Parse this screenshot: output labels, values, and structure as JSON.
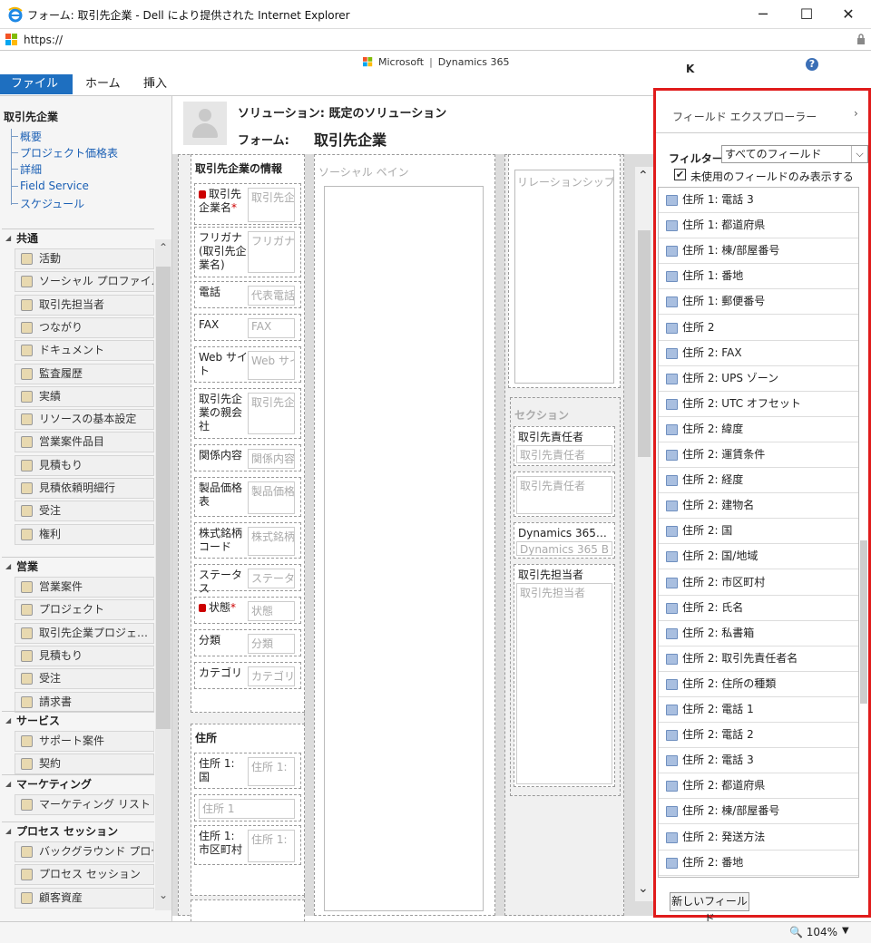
{
  "window": {
    "title": "フォーム: 取引先企業 - Dell により提供された Internet Explorer",
    "minimize": "─",
    "maximize": "☐",
    "close": "✕"
  },
  "address": {
    "url": "https://"
  },
  "brand": {
    "microsoft": "Microsoft",
    "product": "Dynamics 365",
    "sep": "|"
  },
  "user": {
    "initial": "K"
  },
  "help": "?",
  "ribbon": {
    "file": "ファイル",
    "home": "ホーム",
    "insert": "挿入"
  },
  "nav": {
    "entity": "取引先企業",
    "links": [
      "概要",
      "プロジェクト価格表",
      "詳細",
      "Field Service",
      "スケジュール"
    ],
    "groups": [
      {
        "label": "共通",
        "items": [
          "活動",
          "ソーシャル プロファイル",
          "取引先担当者",
          "つながり",
          "ドキュメント",
          "監査履歴",
          "実績",
          "リソースの基本設定",
          "営業案件品目",
          "見積もり",
          "見積依頼明細行",
          "受注",
          "権利"
        ]
      },
      {
        "label": "営業",
        "items": [
          "営業案件",
          "プロジェクト",
          "取引先企業プロジェ…",
          "見積もり",
          "受注",
          "請求書"
        ]
      },
      {
        "label": "サービス",
        "items": [
          "サポート案件",
          "契約"
        ]
      },
      {
        "label": "マーケティング",
        "items": [
          "マーケティング リスト"
        ]
      },
      {
        "label": "プロセス セッション",
        "items": [
          "バックグラウンド プロセス",
          "プロセス セッション",
          "顧客資産"
        ]
      }
    ]
  },
  "formhead": {
    "solution": "ソリューション: 既定のソリューション",
    "form_label": "フォーム:",
    "form_name": "取引先企業"
  },
  "form": {
    "section_info": "取引先企業の情報",
    "fields": [
      {
        "label": "取引先企業名",
        "placeholder": "取引先企",
        "required": "*"
      },
      {
        "label": "フリガナ (取引先企業名)",
        "placeholder": "フリガナ ("
      },
      {
        "label": "電話",
        "placeholder": "代表電話"
      },
      {
        "label": "FAX",
        "placeholder": "FAX"
      },
      {
        "label": "Web サイト",
        "placeholder": "Web サイ"
      },
      {
        "label": "取引先企業の親会社",
        "placeholder": "取引先企"
      },
      {
        "label": "関係内容",
        "placeholder": "関係内容"
      },
      {
        "label": "製品価格表",
        "placeholder": "製品価格"
      },
      {
        "label": "株式銘柄コード",
        "placeholder": "株式銘柄"
      },
      {
        "label": "ステータス",
        "placeholder": "ステータス"
      },
      {
        "label": "状態",
        "placeholder": "状態",
        "required": "*"
      },
      {
        "label": "分類",
        "placeholder": "分類"
      },
      {
        "label": "カテゴリ",
        "placeholder": "カテゴリ"
      }
    ],
    "section_address": "住所",
    "address_fields": [
      {
        "label": "住所 1: 国",
        "placeholder": "住所 1:"
      },
      {
        "label": "",
        "placeholder": "住所 1"
      },
      {
        "label": "住所 1: 市区町村",
        "placeholder": "住所 1:"
      }
    ],
    "social_pane": "ソーシャル ペイン",
    "relationship_placeholder": "リレーションシップ アシ",
    "section_label": "セクション",
    "right_fields": [
      {
        "label": "取引先責任者",
        "placeholder": "取引先責任者"
      },
      {
        "label": "",
        "placeholder": "取引先責任者"
      },
      {
        "label": "Dynamics 365…",
        "placeholder": "Dynamics 365 B"
      },
      {
        "label": "取引先担当者",
        "placeholder": "取引先担当者"
      }
    ]
  },
  "explorer": {
    "title": "フィールド エクスプローラー",
    "arrow": "›",
    "filter_label": "フィルター",
    "filter_value": "すべてのフィールド",
    "unused_only": "未使用のフィールドのみ表示する",
    "unused_checked": "✔",
    "fields": [
      "住所 1: 電話 3",
      "住所 1: 都道府県",
      "住所 1: 棟/部屋番号",
      "住所 1: 番地",
      "住所 1: 郵便番号",
      "住所 2",
      "住所 2: FAX",
      "住所 2: UPS ゾーン",
      "住所 2: UTC オフセット",
      "住所 2: 緯度",
      "住所 2: 運賃条件",
      "住所 2: 経度",
      "住所 2: 建物名",
      "住所 2: 国",
      "住所 2: 国/地域",
      "住所 2: 市区町村",
      "住所 2: 氏名",
      "住所 2: 私書箱",
      "住所 2: 取引先責任者名",
      "住所 2: 住所の種類",
      "住所 2: 電話 1",
      "住所 2: 電話 2",
      "住所 2: 電話 3",
      "住所 2: 都道府県",
      "住所 2: 棟/部屋番号",
      "住所 2: 発送方法",
      "住所 2: 番地"
    ],
    "new_field": "新しいフィールド"
  },
  "status": {
    "zoom": "104%"
  }
}
